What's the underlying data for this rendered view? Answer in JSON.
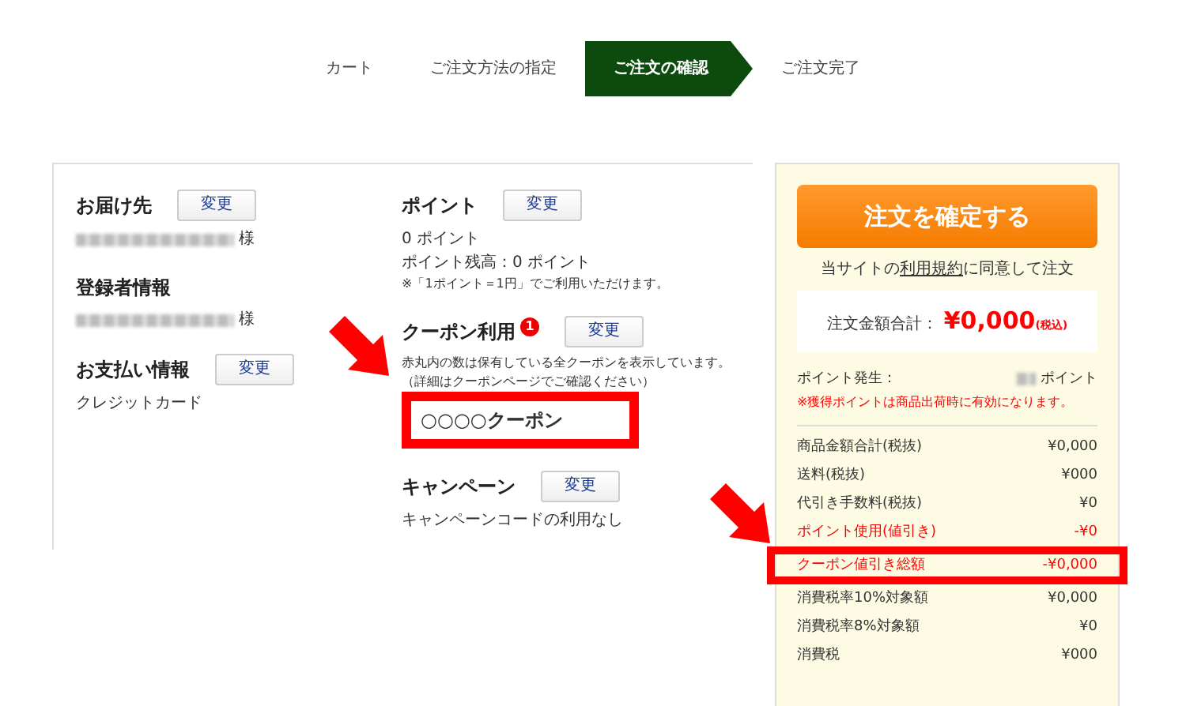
{
  "steps": [
    {
      "label": "カート",
      "selected": false
    },
    {
      "label": "ご注文方法の指定",
      "selected": false
    },
    {
      "label": "ご注文の確認",
      "selected": true
    },
    {
      "label": "ご注文完了",
      "selected": false
    }
  ],
  "left_column": [
    {
      "title": "お届け先",
      "button": "変更",
      "lines": [
        {
          "kind": "redacted",
          "text": "様"
        }
      ]
    },
    {
      "title": "登録者情報",
      "lines": [
        {
          "kind": "redacted",
          "text": "様"
        }
      ]
    },
    {
      "title": "お支払い情報",
      "button": "変更",
      "lines": [
        {
          "kind": "text",
          "text": "クレジットカード"
        }
      ]
    }
  ],
  "right_column": [
    {
      "title": "ポイント",
      "button": "変更",
      "lines": [
        {
          "kind": "text",
          "text": "0 ポイント"
        },
        {
          "kind": "text",
          "text": "ポイント残高：0 ポイント"
        },
        {
          "kind": "note",
          "text": "※「1ポイント＝1円」でご利用いただけます。"
        }
      ]
    },
    {
      "title": "クーポン利用",
      "badge": "1",
      "button": "変更",
      "lines": [
        {
          "kind": "note",
          "text": "赤丸内の数は保有している全クーポンを表示しています。"
        },
        {
          "kind": "note",
          "text": "（詳細はクーポンページでご確認ください）"
        },
        {
          "kind": "coupon",
          "text": "○○○○クーポン",
          "highlighted": true
        }
      ]
    },
    {
      "title": "キャンペーン",
      "button": "変更",
      "lines": [
        {
          "kind": "text",
          "text": "キャンペーンコードの利用なし"
        }
      ]
    }
  ],
  "summary": {
    "confirm_button": "注文を確定する",
    "agreement": [
      {
        "kind": "text",
        "text": "当サイトの"
      },
      {
        "kind": "link",
        "text": "利用規約"
      },
      {
        "kind": "text",
        "text": "に同意して注文"
      }
    ],
    "total_label": "注文金額合計：",
    "total_value": "¥0,000",
    "total_tax": "(税込)",
    "points_label": "ポイント発生：",
    "points_unit": "ポイント",
    "points_note": "※獲得ポイントは商品出荷時に有効になります。",
    "rows": [
      {
        "label": "商品金額合計(税抜)",
        "value": "¥0,000",
        "kind": "normal",
        "highlighted": false
      },
      {
        "label": "送料(税抜)",
        "value": "¥000",
        "kind": "normal",
        "highlighted": false
      },
      {
        "label": "代引き手数料(税抜)",
        "value": "¥0",
        "kind": "normal",
        "highlighted": false
      },
      {
        "label": "ポイント使用(値引き)",
        "value": "-¥0",
        "kind": "discount",
        "highlighted": false
      },
      {
        "label": "クーポン値引き総額",
        "value": "-¥0,000",
        "kind": "discount",
        "highlighted": true
      },
      {
        "label": "消費税率10%対象額",
        "value": "¥0,000",
        "kind": "normal",
        "highlighted": false
      },
      {
        "label": "消費税率8%対象額",
        "value": "¥0",
        "kind": "normal",
        "highlighted": false
      },
      {
        "label": "消費税",
        "value": "¥000",
        "kind": "normal",
        "highlighted": false
      }
    ]
  }
}
